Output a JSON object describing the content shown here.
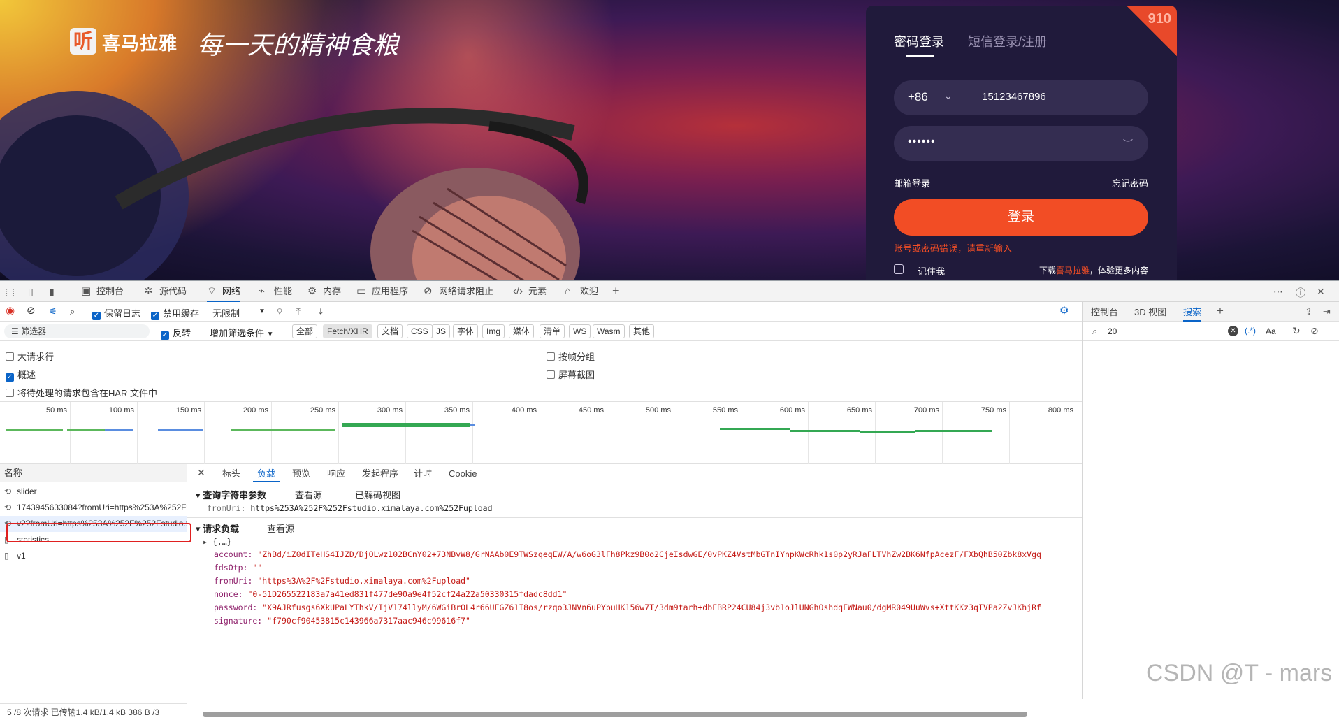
{
  "site": {
    "logo_glyph": "听",
    "logo_text": "喜马拉雅",
    "slogan": "每一天的精神食粮",
    "corner_badge": "910",
    "tabs": [
      "密码登录",
      "短信登录/注册"
    ],
    "phone_code": "+86",
    "phone_value": "15123467896",
    "password_mask": "••••••",
    "email_login": "邮箱登录",
    "forgot": "忘记密码",
    "login_button": "登录",
    "error": "账号或密码错误，请重新输入",
    "remember": "记住我",
    "download_pre": "下载",
    "download_brand": "喜马拉雅",
    "download_post": "，体验更多内容"
  },
  "devtools": {
    "main_tabs": [
      {
        "label": "控制台",
        "icon": "console-icon"
      },
      {
        "label": "源代码",
        "icon": "bug-icon"
      },
      {
        "label": "网络",
        "icon": "wifi-icon"
      },
      {
        "label": "性能",
        "icon": "performance-icon"
      },
      {
        "label": "内存",
        "icon": "memory-icon"
      },
      {
        "label": "应用程序",
        "icon": "application-icon"
      },
      {
        "label": "网络请求阻止",
        "icon": "block-icon"
      },
      {
        "label": "元素",
        "icon": "code-icon"
      },
      {
        "label": "欢迎",
        "icon": "home-icon"
      }
    ],
    "toolbar": {
      "preserve_log": "保留日志",
      "disable_cache": "禁用缓存",
      "throttle": "无限制"
    },
    "filter": {
      "placeholder": "筛选器",
      "invert": "反转",
      "more_filters": "增加筛选条件",
      "types": [
        "全部",
        "Fetch/XHR",
        "文档",
        "CSS",
        "JS",
        "字体",
        "Img",
        "媒体",
        "清单",
        "WS",
        "Wasm",
        "其他"
      ],
      "active_type": "Fetch/XHR"
    },
    "options": {
      "big_rows": "大请求行",
      "overview": "概述",
      "har": "将待处理的请求包含在HAR 文件中",
      "group_by_frame": "按帧分组",
      "screenshots": "屏幕截图"
    },
    "timeline_ticks": [
      "50 ms",
      "100 ms",
      "150 ms",
      "200 ms",
      "250 ms",
      "300 ms",
      "350 ms",
      "400 ms",
      "450 ms",
      "500 ms",
      "550 ms",
      "600 ms",
      "650 ms",
      "700 ms",
      "750 ms",
      "800 ms"
    ],
    "requests_header": "名称",
    "requests": [
      "slider",
      "1743945633084?fromUri=https%253A%252F%252Fstudio.ximalaya.com%252Fupload",
      "v2?fromUri=https%253A%252F%252Fstudio.ximalaya.com%252Fupload",
      "statistics",
      "v1"
    ],
    "status": "5 /8 次请求   已传输1.4 kB/1.4 kB   386 B /3",
    "detail_tabs": [
      "标头",
      "负载",
      "预览",
      "响应",
      "发起程序",
      "计时",
      "Cookie"
    ],
    "active_detail_tab": "负载",
    "query_section": "查询字符串参数",
    "view_source": "查看源",
    "view_decoded": "已解码视图",
    "query_key": "fromUri:",
    "query_value": "https%253A%252F%252Fstudio.ximalaya.com%252Fupload",
    "payload_section": "请求负载",
    "payload_preview": "{,…}",
    "payload": [
      {
        "key": "account:",
        "value": "\"ZhBd/iZ0dITeHS4IJZD/DjOLwz102BCnY02+73NBvW8/GrNAAb0E9TWSzqeqEW/A/w6oG3lFh8Pkz9B0o2CjeIsdwGE/0vPKZ4VstMbGTnIYnpKWcRhk1s0p2yRJaFLTVhZw2BK6NfpAcezF/FXbQhB50Zbk8xVgq"
      },
      {
        "key": "fdsOtp:",
        "value": "\"\""
      },
      {
        "key": "fromUri:",
        "value": "\"https%3A%2F%2Fstudio.ximalaya.com%2Fupload\""
      },
      {
        "key": "nonce:",
        "value": "\"0-51D265522183a7a41ed831f477de90a9e4f52cf24a22a50330315fdadc8dd1\""
      },
      {
        "key": "password:",
        "value": "\"X9AJRfusgs6XkUPaLYThkV/IjV174llyM/6WGiBrOL4r66UEGZ61I8os/rzqo3JNVn6uPYbuHK156w7T/3dm9tarh+dbFBRP24CU84j3vb1oJlUNGhOshdqFWNau0/dgMR049UuWvs+XttKKz3qIVPa2ZvJKhjRf"
      },
      {
        "key": "signature:",
        "value": "\"f790cf90453815c143966a7317aac946c99616f7\""
      }
    ],
    "right_tabs": [
      "控制台",
      "3D 视图",
      "搜索"
    ],
    "active_right_tab": "搜索",
    "search_value": "20",
    "search_regex": "(.*)",
    "search_case": "Aa"
  },
  "watermark": "CSDN @T - mars",
  "colors": {
    "accent": "#0a64c8",
    "brand": "#f24d25",
    "card": "#201a3b"
  }
}
